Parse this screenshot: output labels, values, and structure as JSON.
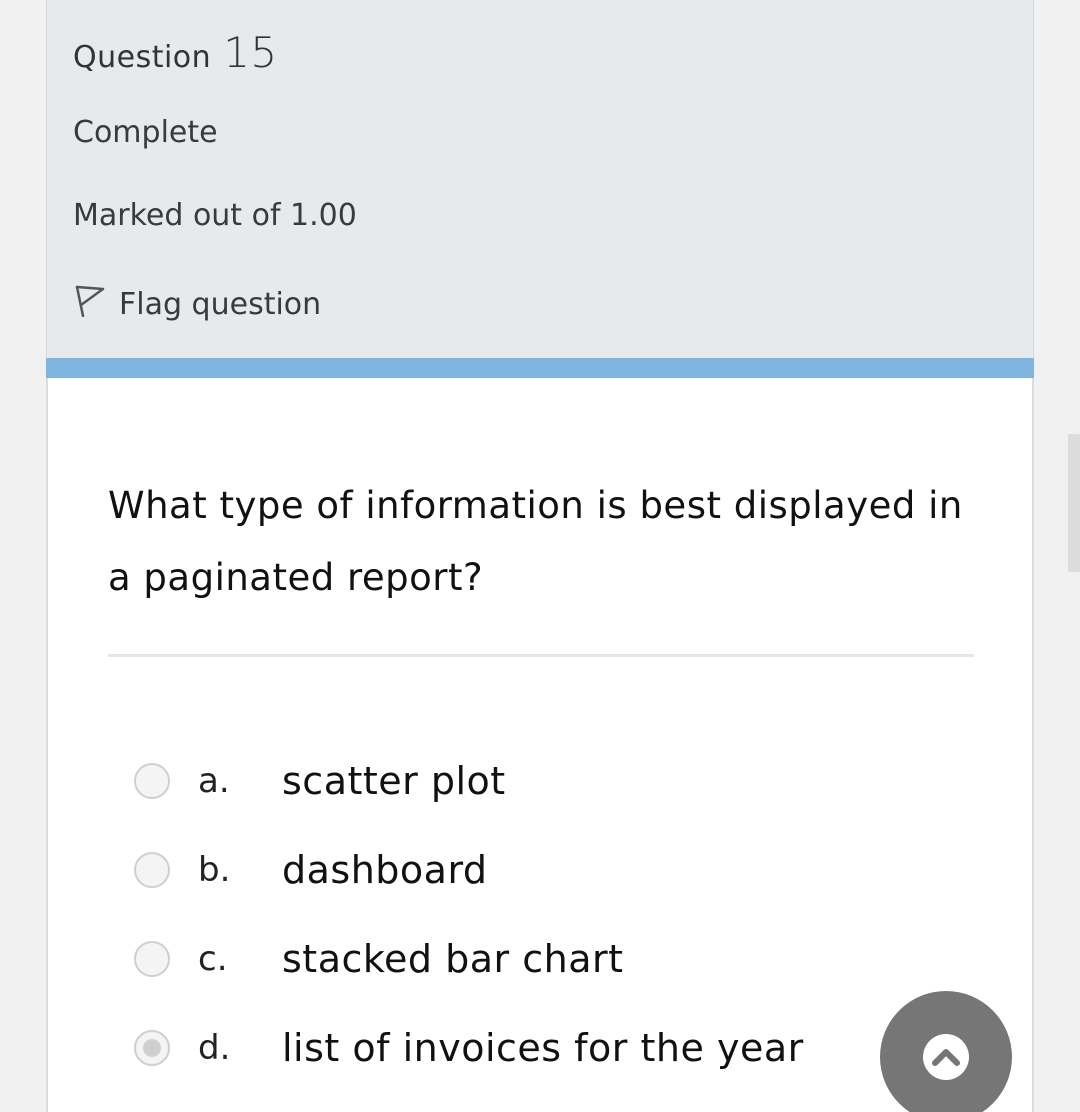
{
  "question_info": {
    "label": "Question",
    "number": "15",
    "state": "Complete",
    "grade": "Marked out of 1.00",
    "flag_label": "Flag question"
  },
  "question": {
    "text": "What type of information is best displayed in a paginated report?"
  },
  "options": [
    {
      "letter": "a.",
      "text": "scatter plot",
      "selected": false
    },
    {
      "letter": "b.",
      "text": "dashboard",
      "selected": false
    },
    {
      "letter": "c.",
      "text": "stacked bar chart",
      "selected": false
    },
    {
      "letter": "d.",
      "text": "list of invoices for the year",
      "selected": true
    }
  ],
  "icons": {
    "flag": "flag-outline-icon",
    "scroll_top": "chevron-up-icon"
  },
  "colors": {
    "info_background": "#e7eaed",
    "accent_bar": "#7fb5de",
    "fab_background": "#767676"
  }
}
